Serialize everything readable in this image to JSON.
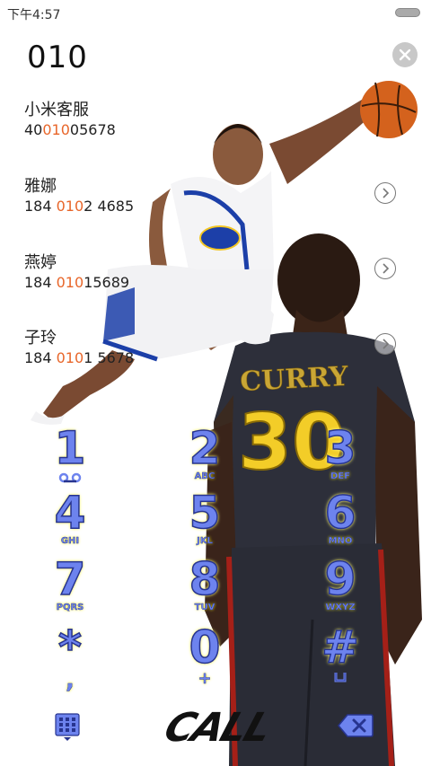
{
  "status_bar": {
    "time": "下午4:57"
  },
  "search": {
    "number": "010"
  },
  "contacts": [
    {
      "name": "小米客服",
      "number_before": "40",
      "number_match": "010",
      "number_after": "05678",
      "has_detail": false
    },
    {
      "name": "雅娜",
      "number_before": "184 ",
      "number_match": "010",
      "number_after": "2 4685",
      "has_detail": true
    },
    {
      "name": "燕婷",
      "number_before": "184 ",
      "number_match": "010",
      "number_after": "15689",
      "has_detail": true
    },
    {
      "name": "子玲",
      "number_before": "184 ",
      "number_match": "010",
      "number_after": "1 5678",
      "has_detail": true
    }
  ],
  "dialpad": {
    "keys": [
      {
        "digit": "1",
        "letters": ""
      },
      {
        "digit": "2",
        "letters": "ABC"
      },
      {
        "digit": "3",
        "letters": "DEF"
      },
      {
        "digit": "4",
        "letters": "GHI"
      },
      {
        "digit": "5",
        "letters": "JKL"
      },
      {
        "digit": "6",
        "letters": "MNO"
      },
      {
        "digit": "7",
        "letters": "PQRS"
      },
      {
        "digit": "8",
        "letters": "TUV"
      },
      {
        "digit": "9",
        "letters": "WXYZ"
      },
      {
        "digit": "*",
        "letters": ","
      },
      {
        "digit": "0",
        "letters": "+"
      },
      {
        "digit": "#",
        "letters": ""
      }
    ]
  },
  "bottom_bar": {
    "call_label": "CALL"
  },
  "jersey": {
    "name": "CURRY",
    "number": "30"
  },
  "colors": {
    "accent_match": "#e8662a",
    "key_fill": "#6d83ee",
    "key_stroke": "#27348f",
    "key_glow": "#fff200"
  },
  "icons": {
    "clear": "close-icon",
    "detail": "chevron-right-icon",
    "voicemail": "voicemail-icon",
    "pound_extra": "u-shape-icon",
    "dialpad_toggle": "dialpad-icon",
    "backspace": "backspace-icon"
  }
}
